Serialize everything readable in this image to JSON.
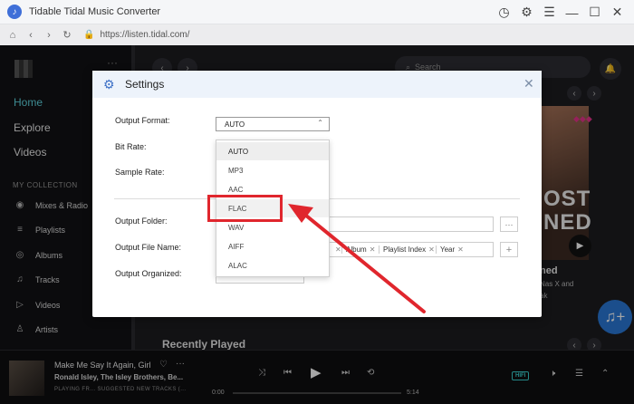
{
  "window": {
    "title": "Tidable Tidal Music Converter"
  },
  "address": {
    "url": "https://listen.tidal.com/"
  },
  "sidebar": {
    "nav": [
      {
        "label": "Home"
      },
      {
        "label": "Explore"
      },
      {
        "label": "Videos"
      }
    ],
    "collection_header": "MY COLLECTION",
    "collection": [
      {
        "label": "Mixes & Radio",
        "icon": "radio-icon"
      },
      {
        "label": "Playlists",
        "icon": "playlist-icon"
      },
      {
        "label": "Albums",
        "icon": "album-icon"
      },
      {
        "label": "Tracks",
        "icon": "track-icon"
      },
      {
        "label": "Videos",
        "icon": "video-icon"
      },
      {
        "label": "Artists",
        "icon": "artist-icon"
      }
    ]
  },
  "main": {
    "search_placeholder": "Search",
    "album_text_line1": "OST",
    "album_text_line2": "NED",
    "card_title": "ned",
    "card_sub1": "Nas X and",
    "card_sub2": "ak",
    "recently_played": "Recently Played"
  },
  "settings": {
    "title": "Settings",
    "labels": {
      "output_format": "Output Format:",
      "bit_rate": "Bit Rate:",
      "sample_rate": "Sample Rate:",
      "output_folder": "Output Folder:",
      "output_file_name": "Output File Name:",
      "output_organized": "Output Organized:"
    },
    "format_value": "AUTO",
    "format_options": [
      "AUTO",
      "MP3",
      "AAC",
      "FLAC",
      "WAV",
      "AIFF",
      "ALAC"
    ],
    "highlighted_option": "FLAC",
    "file_name_tags": [
      "Album",
      "Playlist Index",
      "Year"
    ],
    "folder_more": "···",
    "add_tag": "+"
  },
  "player": {
    "track_title": "Make Me Say It Again, Girl",
    "artists": "Ronald Isley,  The Isley Brothers,  Be...",
    "status": "PLAYING FR...  SUGGESTED NEW TRACKS (...",
    "time_current": "0:00",
    "time_total": "5:14",
    "quality_badge": "HIFI",
    "progress": 0
  },
  "colors": {
    "accent": "#5fd6e0",
    "highlight_box": "#e0262d",
    "brand_blue": "#2a79d8"
  }
}
